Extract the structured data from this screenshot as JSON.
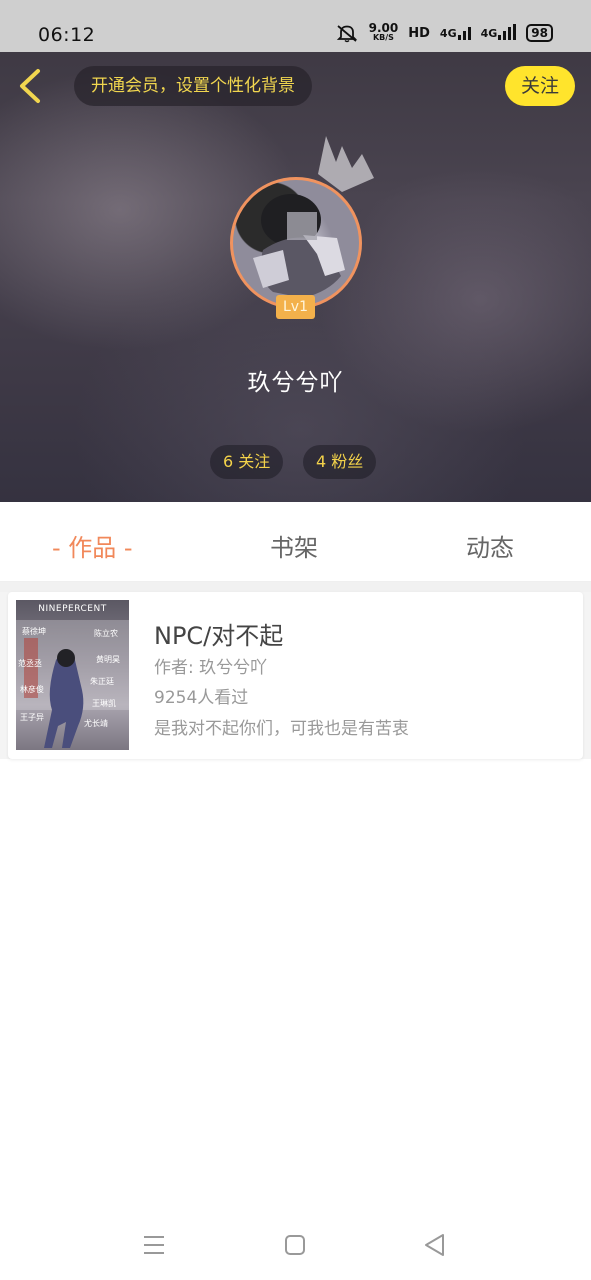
{
  "status_bar": {
    "time": "06:12",
    "speed_value": "9.00",
    "speed_unit": "KB/S",
    "hd_label": "HD",
    "network_1": "4G",
    "network_2": "4G",
    "battery": "98"
  },
  "header": {
    "back_icon": "chevron-left-icon",
    "vip_prompt": "开通会员，设置个性化背景",
    "follow_label": "关注",
    "crown_icon": "crown-icon",
    "level": "Lv1",
    "username": "玖兮兮吖",
    "following": "6 关注",
    "fans": "4 粉丝"
  },
  "tabs": [
    {
      "label": "- 作品 -",
      "active": true
    },
    {
      "label": "书架",
      "active": false
    },
    {
      "label": "动态",
      "active": false
    }
  ],
  "works": [
    {
      "cover_text": "NINEPERCENT",
      "title": "NPC/对不起",
      "author": "作者: 玖兮兮吖",
      "views": "9254人看过",
      "description": "是我对不起你们，可我也是有苦衷"
    }
  ],
  "nav_bar": {
    "icons": [
      "menu-icon",
      "home-square-icon",
      "back-triangle-icon"
    ]
  },
  "colors": {
    "accent_orange": "#f1885a",
    "accent_yellow": "#ffe42c",
    "stat_yellow": "#f3d24a"
  }
}
